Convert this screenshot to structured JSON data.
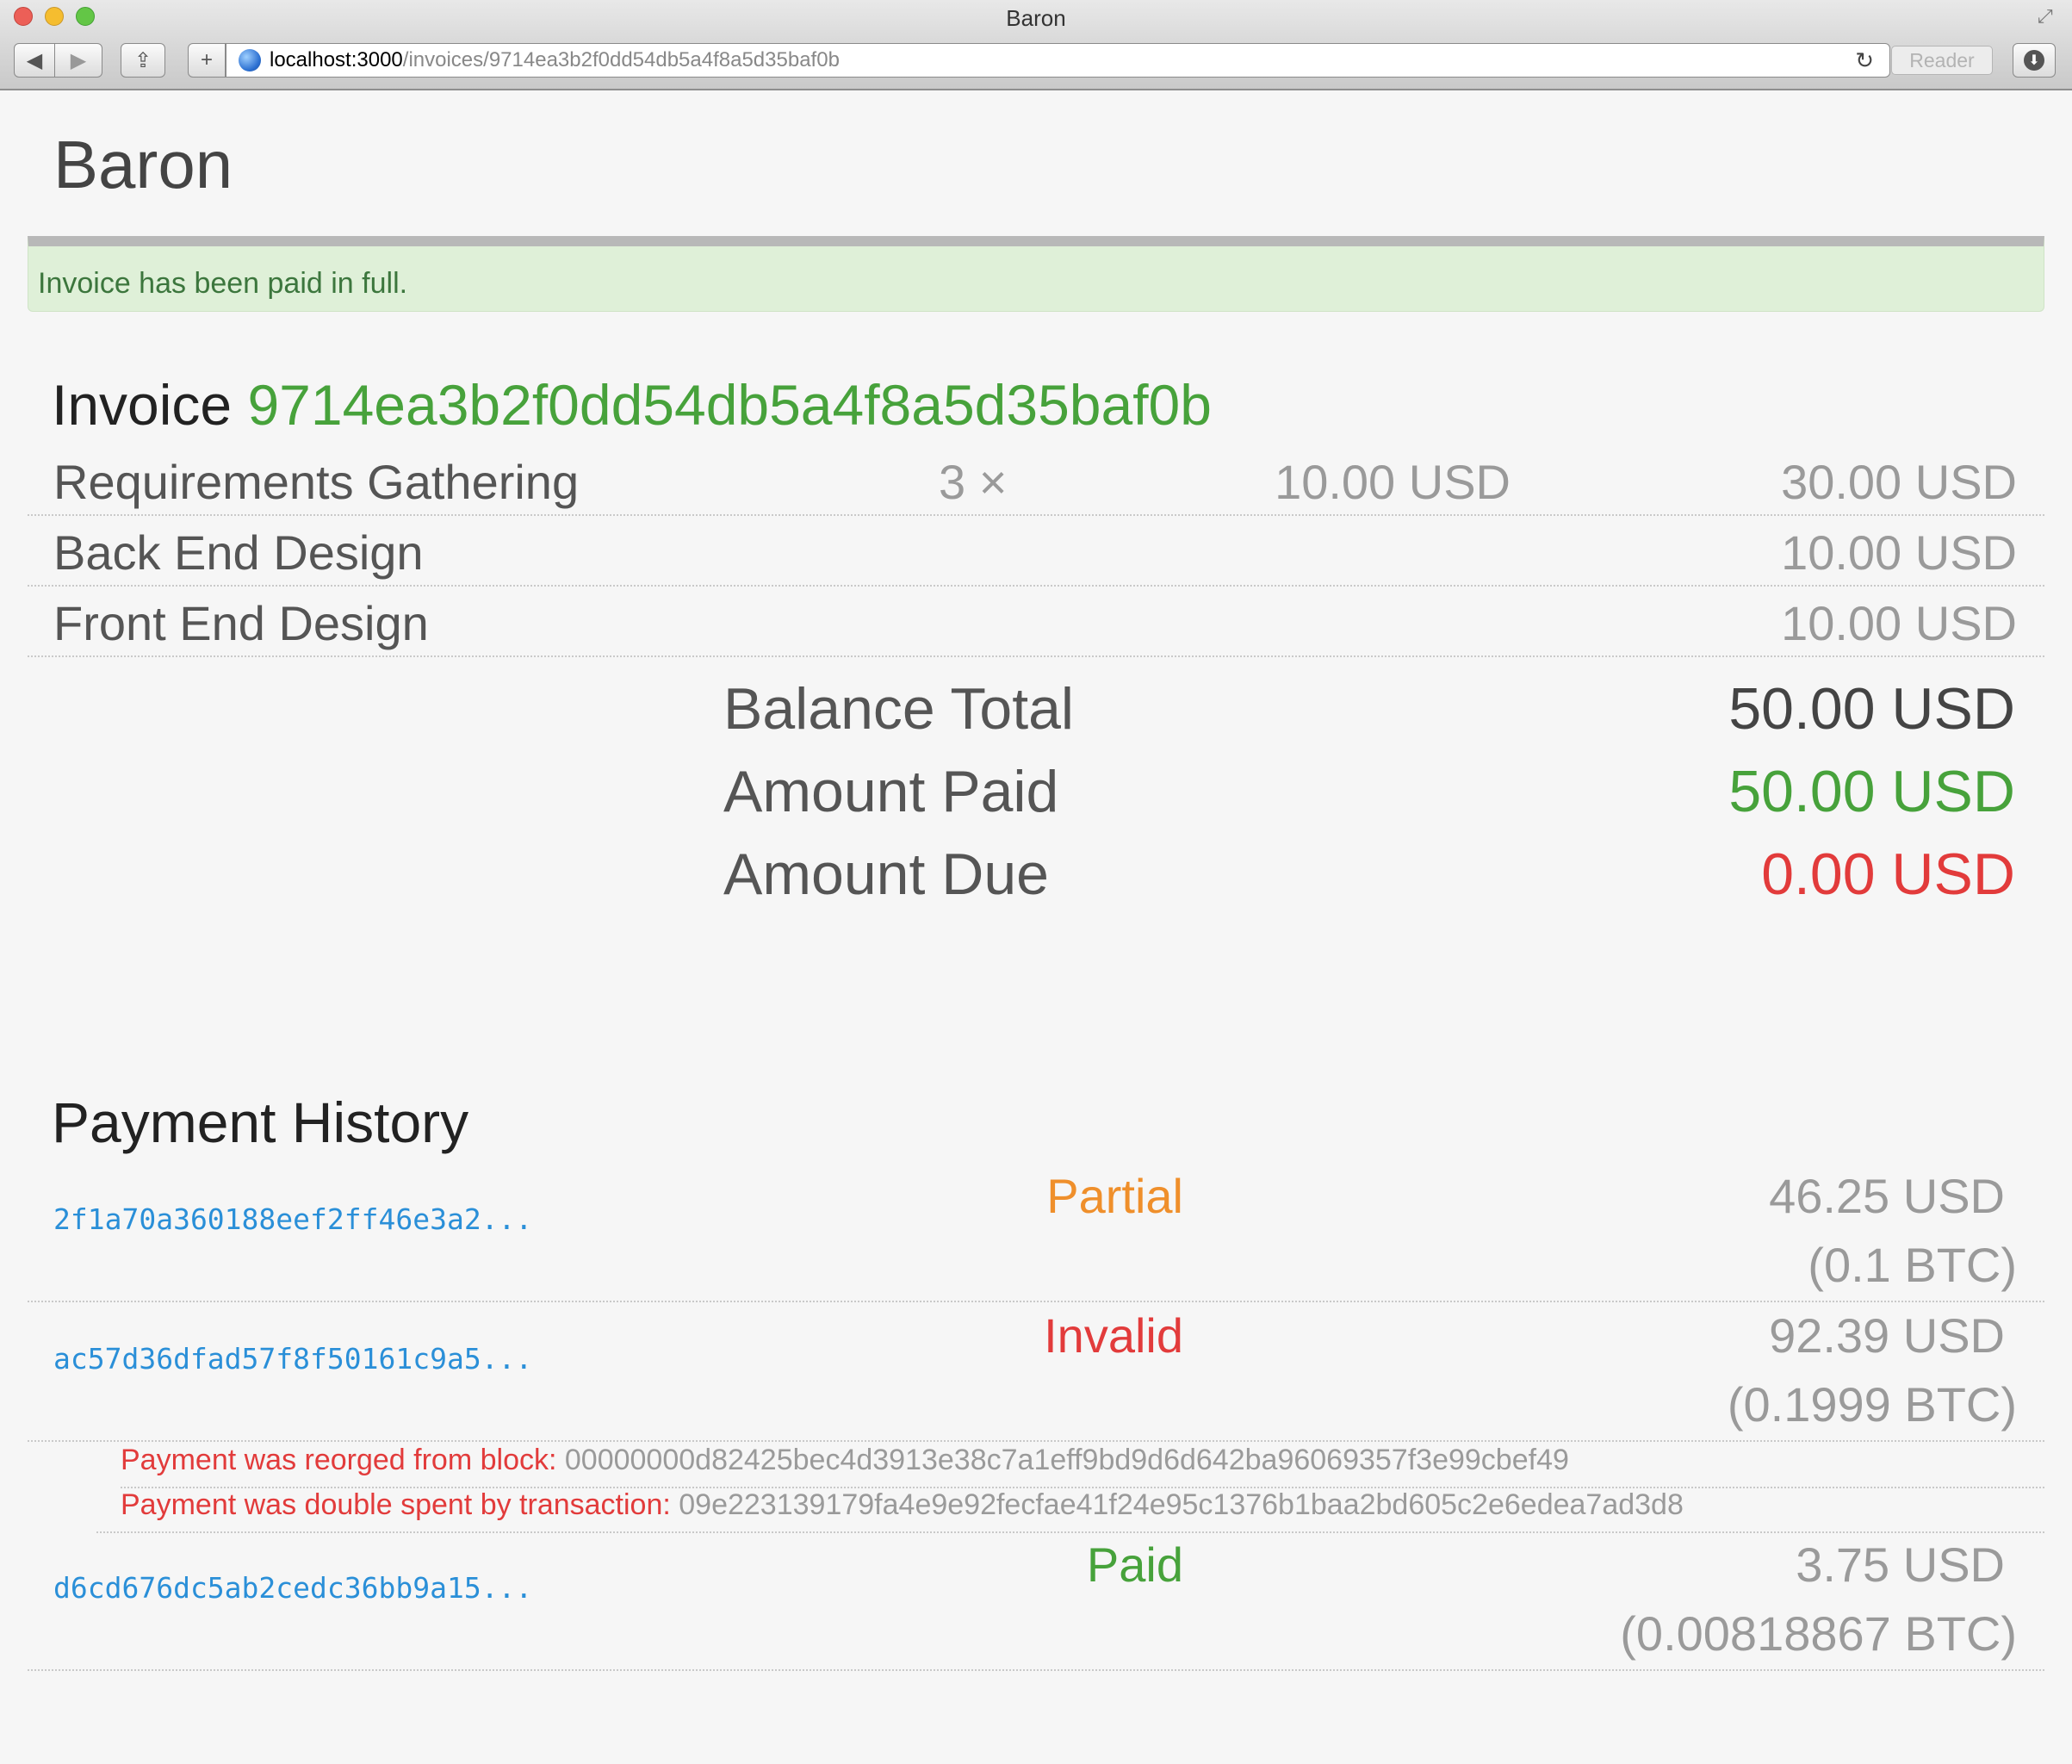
{
  "window": {
    "title": "Baron",
    "url_host": "localhost:3000",
    "url_path": "/invoices/9714ea3b2f0dd54db5a4f8a5d35baf0b",
    "reader_label": "Reader"
  },
  "brand": "Baron",
  "alert": {
    "text": "Invoice has been paid in full."
  },
  "invoice": {
    "label": "Invoice",
    "id": "9714ea3b2f0dd54db5a4f8a5d35baf0b",
    "line_items": [
      {
        "description": "Requirements Gathering",
        "quantity": "3 ×",
        "unit_price": "10.00 USD",
        "amount": "30.00 USD"
      },
      {
        "description": "Back End Design",
        "quantity": "",
        "unit_price": "",
        "amount": "10.00 USD"
      },
      {
        "description": "Front End Design",
        "quantity": "",
        "unit_price": "",
        "amount": "10.00 USD"
      }
    ],
    "totals": {
      "balance_label": "Balance Total",
      "balance_value": "50.00 USD",
      "paid_label": "Amount Paid",
      "paid_value": "50.00 USD",
      "due_label": "Amount Due",
      "due_value": "0.00 USD"
    }
  },
  "payment_history": {
    "heading": "Payment History",
    "payments": [
      {
        "txid": "2f1a70a360188eef2ff46e3a2...",
        "status": "Partial",
        "usd": "46.25 USD",
        "btc": "(0.1 BTC)"
      },
      {
        "txid": "ac57d36dfad57f8f50161c9a5...",
        "status": "Invalid",
        "usd": "92.39 USD",
        "btc": "(0.1999 BTC)",
        "notes": [
          {
            "label": "Payment was reorged from block:",
            "value": "00000000d82425bec4d3913e38c7a1eff9bd9d6d642ba96069357f3e99cbef49"
          },
          {
            "label": "Payment was double spent by transaction:",
            "value": "09e223139179fa4e9e92fecfae41f24e95c1376b1baa2bd605c2e6edea7ad3d8"
          }
        ]
      },
      {
        "txid": "d6cd676dc5ab2cedc36bb9a15...",
        "status": "Paid",
        "usd": "3.75 USD",
        "btc": "(0.00818867 BTC)"
      }
    ]
  },
  "colors": {
    "accent_green": "#47a23b",
    "alert_bg": "#dff0d8",
    "error_red": "#e23b3b",
    "partial_orange": "#ef8f2b",
    "link_blue": "#2a8fd8"
  },
  "icons": [
    "back-arrow-icon",
    "forward-arrow-icon",
    "share-icon",
    "plus-icon",
    "globe-icon",
    "reload-icon",
    "download-icon",
    "fullscreen-icon"
  ]
}
